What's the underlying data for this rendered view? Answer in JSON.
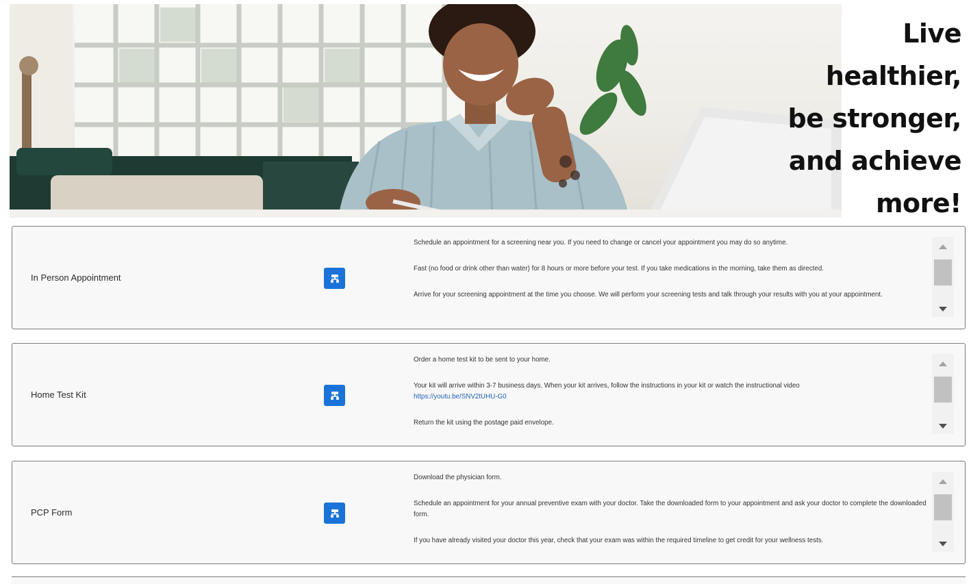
{
  "hero": {
    "tagline": [
      "Live",
      "healthier,",
      "be stronger,",
      "and achieve",
      "more!"
    ]
  },
  "cards": [
    {
      "title": "In Person Appointment",
      "button_icon": "hierarchy-icon",
      "paragraphs": [
        "Schedule an appointment for a screening near you. If you need to change or cancel your appointment you may do so anytime.",
        "Fast (no food or drink other than water) for 8 hours or more before your test. If you take medications in the morning, take them as directed.",
        "Arrive for your screening appointment at the time you choose. We will perform your screening tests and talk through your results with you at your appointment."
      ]
    },
    {
      "title": "Home Test Kit",
      "button_icon": "hierarchy-icon",
      "paragraphs": [
        "Order a home test kit to be sent to your home.",
        "Your kit will arrive within 3-7 business days. When your kit arrives, follow the instructions in your kit or watch the instructional video",
        "Return the kit using the postage paid envelope."
      ],
      "link": "https://youtu.be/SNV2tUHU-G0"
    },
    {
      "title": "PCP Form",
      "button_icon": "hierarchy-icon",
      "paragraphs": [
        "Download the physician form.",
        "Schedule an appointment for your annual preventive exam with your doctor. Take the downloaded form to your appointment and ask your doctor to complete the downloaded form.",
        "If you have already visited your doctor this year, check that your exam was within the required timeline to get credit for your wellness tests."
      ]
    }
  ],
  "colors": {
    "button": "#1a73d9",
    "link": "#1f5fb3",
    "card_border": "#7a7a7a",
    "card_bg": "#f8f8f8"
  }
}
